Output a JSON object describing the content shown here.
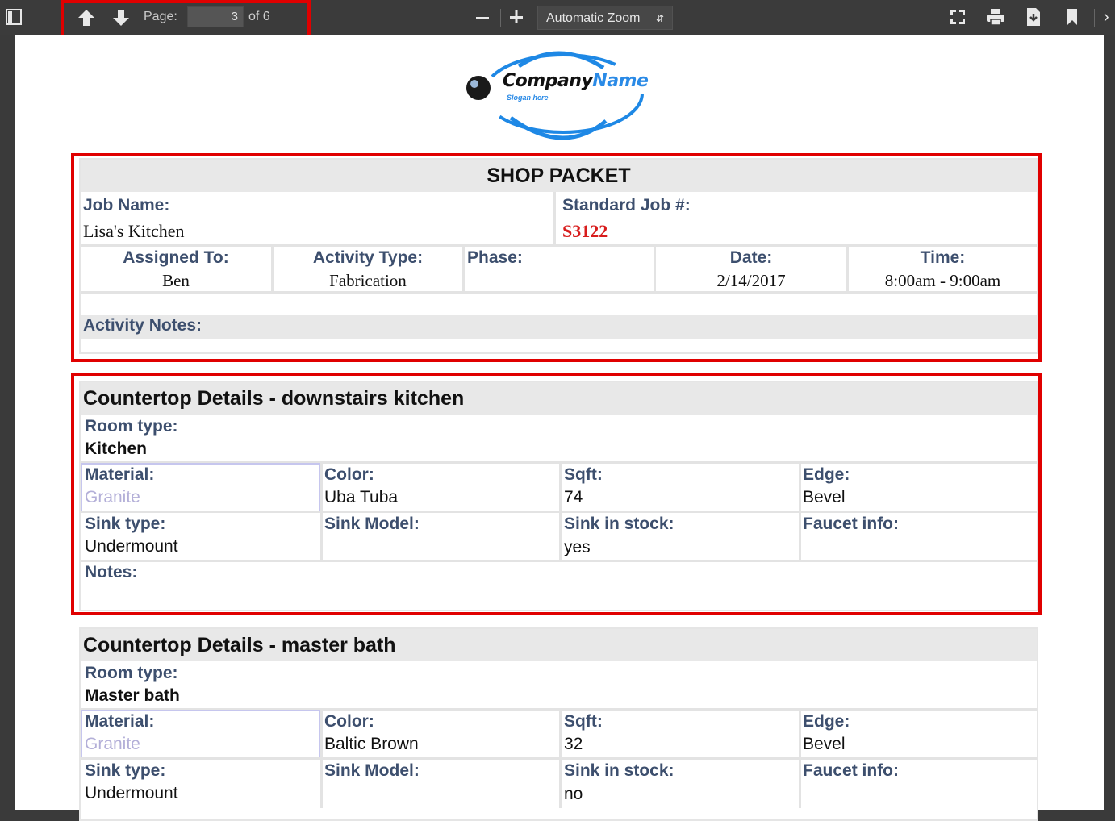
{
  "toolbar": {
    "page_label": "Page:",
    "page_current": "3",
    "page_total": "of 6",
    "zoom": "Automatic Zoom"
  },
  "logo": {
    "name_dark": "Company",
    "name_accent": "Name",
    "slogan": "Slogan here"
  },
  "packet": {
    "title": "SHOP PACKET",
    "job_name_label": "Job Name:",
    "job_name": "Lisa's Kitchen",
    "standard_job_label": "Standard Job #:",
    "standard_job": "S3122",
    "assigned_label": "Assigned To:",
    "assigned": "Ben",
    "activity_type_label": "Activity Type:",
    "activity_type": "Fabrication",
    "phase_label": "Phase:",
    "date_label": "Date:",
    "date": "2/14/2017",
    "time_label": "Time:",
    "time": "8:00am - 9:00am",
    "notes_label": "Activity Notes:"
  },
  "countertops": [
    {
      "title": "Countertop Details - downstairs kitchen",
      "room_type_label": "Room type:",
      "room_type": "Kitchen",
      "material_label": "Material:",
      "material": "Granite",
      "color_label": "Color:",
      "color": "Uba Tuba",
      "sqft_label": "Sqft:",
      "sqft": "74",
      "edge_label": "Edge:",
      "edge": "Bevel",
      "sink_type_label": "Sink type:",
      "sink_type": "Undermount",
      "sink_model_label": "Sink Model:",
      "sink_stock_label": "Sink in stock:",
      "sink_stock": "yes",
      "faucet_label": "Faucet info:",
      "notes_label": "Notes:"
    },
    {
      "title": "Countertop Details - master bath",
      "room_type_label": "Room type:",
      "room_type": "Master bath",
      "material_label": "Material:",
      "material": "Granite",
      "color_label": "Color:",
      "color": "Baltic Brown",
      "sqft_label": "Sqft:",
      "sqft": "32",
      "edge_label": "Edge:",
      "edge": "Bevel",
      "sink_type_label": "Sink type:",
      "sink_type": "Undermount",
      "sink_model_label": "Sink Model:",
      "sink_stock_label": "Sink in stock:",
      "sink_stock": "no",
      "faucet_label": "Faucet info:"
    }
  ]
}
